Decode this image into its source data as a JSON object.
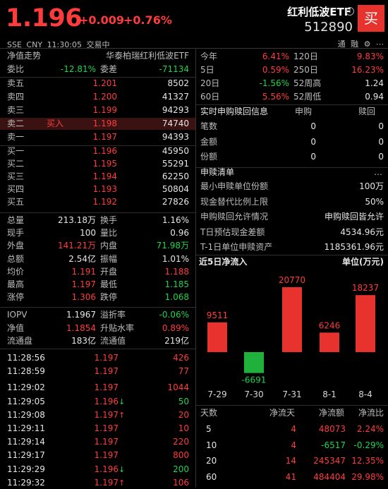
{
  "header": {
    "price": "1.196",
    "change": "+0.009",
    "change_pct": "+0.76%",
    "name": "红利低波ETF",
    "code": "512890",
    "buy": "买",
    "exchange": "SSE",
    "currency": "CNY",
    "time": "11:30:05",
    "status": "交易中",
    "tools": "通 融 ⚙ ⋯",
    "info": "!"
  },
  "left": {
    "headline": {
      "label": "净值走势",
      "fund": "华泰柏瑞红利低波ETF"
    },
    "ratio": {
      "label1": "委比",
      "value1": "-12.81%",
      "label2": "委差",
      "value2": "-71134"
    },
    "asks": [
      {
        "label": "卖五",
        "tag": "",
        "price": "1.201",
        "vol": "8502"
      },
      {
        "label": "卖四",
        "tag": "",
        "price": "1.200",
        "vol": "41327"
      },
      {
        "label": "卖三",
        "tag": "",
        "price": "1.199",
        "vol": "94293"
      },
      {
        "label": "卖二",
        "tag": "买入",
        "price": "1.198",
        "vol": "74740"
      },
      {
        "label": "卖一",
        "tag": "",
        "price": "1.197",
        "vol": "94393"
      }
    ],
    "bids": [
      {
        "label": "买一",
        "price": "1.196",
        "vol": "45950"
      },
      {
        "label": "买二",
        "price": "1.195",
        "vol": "55291"
      },
      {
        "label": "买三",
        "price": "1.194",
        "vol": "62250"
      },
      {
        "label": "买四",
        "price": "1.193",
        "vol": "50804"
      },
      {
        "label": "买五",
        "price": "1.192",
        "vol": "27826"
      }
    ],
    "stats": [
      {
        "l1": "总量",
        "v1": "213.18万",
        "c1": "white",
        "l2": "换手",
        "v2": "1.16%",
        "c2": "white"
      },
      {
        "l1": "现手",
        "v1": "100",
        "c1": "white",
        "l2": "量比",
        "v2": "0.96",
        "c2": "white"
      },
      {
        "l1": "外盘",
        "v1": "141.21万",
        "c1": "red",
        "l2": "内盘",
        "v2": "71.98万",
        "c2": "green"
      },
      {
        "l1": "总额",
        "v1": "2.54亿",
        "c1": "white",
        "l2": "振幅",
        "v2": "1.01%",
        "c2": "white"
      },
      {
        "l1": "均价",
        "v1": "1.191",
        "c1": "red",
        "l2": "开盘",
        "v2": "1.188",
        "c2": "red"
      },
      {
        "l1": "最高",
        "v1": "1.197",
        "c1": "red",
        "l2": "最低",
        "v2": "1.185",
        "c2": "green"
      },
      {
        "l1": "涨停",
        "v1": "1.306",
        "c1": "red",
        "l2": "跌停",
        "v2": "1.068",
        "c2": "green"
      }
    ],
    "nav": [
      {
        "l1": "IOPV",
        "v1": "1.1967",
        "c1": "white",
        "l2": "溢折率",
        "v2": "-0.06%",
        "c2": "green"
      },
      {
        "l1": "净值",
        "v1": "1.1854",
        "c1": "red",
        "l2": "升贴水率",
        "v2": "0.89%",
        "c2": "red"
      },
      {
        "l1": "流通盘",
        "v1": "183亿",
        "c1": "white",
        "l2": "流通值",
        "v2": "219亿",
        "c2": "white"
      }
    ],
    "ticks": [
      {
        "time": "11:28:56",
        "price": "1.197",
        "arrow": "",
        "vol": "426",
        "vc": "red"
      },
      {
        "time": "11:28:59",
        "price": "1.197",
        "arrow": "",
        "vol": "77",
        "vc": "red"
      },
      {
        "time": "11:29:02",
        "price": "1.197",
        "arrow": "",
        "vol": "1044",
        "vc": "red"
      },
      {
        "time": "11:29:05",
        "price": "1.196",
        "arrow": "↓",
        "vol": "50",
        "vc": "green"
      },
      {
        "time": "11:29:08",
        "price": "1.197",
        "arrow": "↑",
        "vol": "20",
        "vc": "red"
      },
      {
        "time": "11:29:11",
        "price": "1.197",
        "arrow": "",
        "vol": "10",
        "vc": "red"
      },
      {
        "time": "11:29:14",
        "price": "1.197",
        "arrow": "",
        "vol": "220",
        "vc": "red"
      },
      {
        "time": "11:29:17",
        "price": "1.197",
        "arrow": "",
        "vol": "800",
        "vc": "red"
      },
      {
        "time": "11:29:29",
        "price": "1.196",
        "arrow": "↓",
        "vol": "200",
        "vc": "green"
      },
      {
        "time": "11:29:32",
        "price": "1.197",
        "arrow": "↑",
        "vol": "106",
        "vc": "red"
      }
    ]
  },
  "right": {
    "returns": [
      {
        "l1": "今年",
        "v1": "6.41%",
        "c1": "red",
        "l2": "120日",
        "v2": "9.83%",
        "c2": "red"
      },
      {
        "l1": "5日",
        "v1": "0.59%",
        "c1": "red",
        "l2": "250日",
        "v2": "16.23%",
        "c2": "red"
      },
      {
        "l1": "20日",
        "v1": "-1.56%",
        "c1": "green",
        "l2": "52周高",
        "v2": "1.24",
        "c2": "white"
      },
      {
        "l1": "60日",
        "v1": "5.56%",
        "c1": "red",
        "l2": "52周低",
        "v2": "0.94",
        "c2": "white"
      }
    ],
    "realtime": {
      "title": "实时申购赎回信息",
      "col1": "申购",
      "col2": "赎回",
      "rows": [
        {
          "label": "笔数",
          "v1": "0",
          "v2": "0"
        },
        {
          "label": "金额",
          "v1": "0",
          "v2": "0"
        },
        {
          "label": "份额",
          "v1": "0",
          "v2": "0"
        }
      ]
    },
    "list": {
      "title": "申赎清单",
      "more": "…",
      "rows": [
        {
          "label": "最小申赎单位份额",
          "value": "100万"
        },
        {
          "label": "现金替代比例上限",
          "value": "50%"
        },
        {
          "label": "申购赎回允许情况",
          "value": "申购赎回皆允许"
        },
        {
          "label": "T日预估现金差额",
          "value": "4534.96元"
        },
        {
          "label": "T-1日单位申赎资产",
          "value": "1185361.96元"
        }
      ]
    },
    "flow": {
      "title": "近5日净流入",
      "unit": "单位(万元)"
    },
    "table": {
      "headers": [
        "天数",
        "净流天",
        "净流额",
        "净流比"
      ],
      "rows": [
        {
          "days": "5",
          "d": "4",
          "amt": "48073",
          "ac": "red",
          "ratio": "2.24%",
          "rc": "red"
        },
        {
          "days": "10",
          "d": "4",
          "amt": "-6517",
          "ac": "green",
          "ratio": "-0.29%",
          "rc": "green"
        },
        {
          "days": "20",
          "d": "14",
          "amt": "245347",
          "ac": "red",
          "ratio": "12.35%",
          "rc": "red"
        },
        {
          "days": "60",
          "d": "41",
          "amt": "484404",
          "ac": "red",
          "ratio": "29.98%",
          "rc": "red"
        }
      ]
    }
  },
  "chart_data": {
    "type": "bar",
    "categories": [
      "7-29",
      "7-30",
      "7-31",
      "8-1",
      "8-4"
    ],
    "values": [
      9511,
      -6691,
      20770,
      6246,
      18237
    ],
    "title": "近5日净流入",
    "ylabel": "单位(万元)",
    "colors": {
      "positive": "#e8322d",
      "negative": "#1fb13c"
    }
  }
}
